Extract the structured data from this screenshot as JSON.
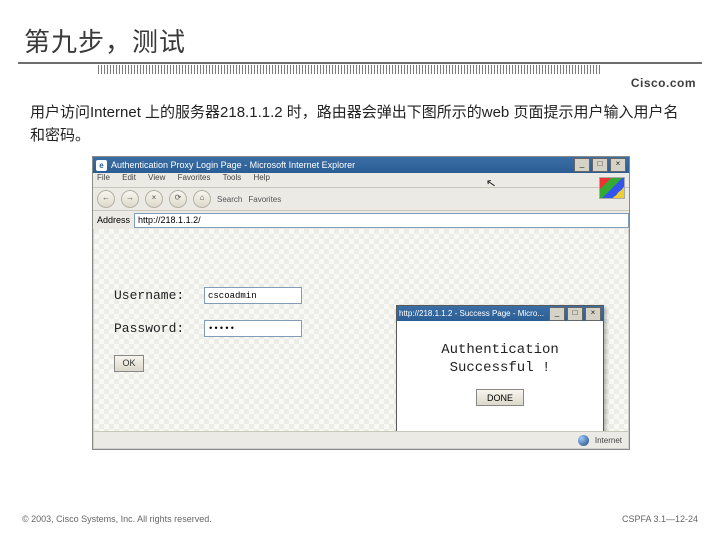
{
  "slide": {
    "title": "第九步，测试",
    "logo": "Cisco.com",
    "body": "用户访问Internet 上的服务器218.1.1.2 时，路由器会弹出下图所示的web 页面提示用户输入用户名和密码。",
    "copyright": "© 2003, Cisco Systems, Inc. All rights reserved.",
    "slidenum": "CSPFA 3.1—12-24"
  },
  "ie": {
    "title": "Authentication Proxy Login Page - Microsoft Internet Explorer",
    "menu": {
      "file": "File",
      "edit": "Edit",
      "view": "View",
      "fav": "Favorites",
      "tools": "Tools",
      "help": "Help"
    },
    "toolbar": {
      "back": "←",
      "fwd": "→",
      "stop": "×",
      "refresh": "⟳",
      "home": "⌂",
      "search": "Search",
      "fav": "Favorites"
    },
    "addr_label": "Address",
    "addr_value": "http://218.1.1.2/",
    "form": {
      "user_label": "Username:",
      "user_value": "cscoadmin",
      "pass_label": "Password:",
      "pass_value": "•••••",
      "ok": "OK"
    },
    "status": {
      "zone": "Internet"
    }
  },
  "popup": {
    "title": "http://218.1.1.2 - Success Page - Micro...",
    "line1": "Authentication",
    "line2": "Successful !",
    "btn": "DONE"
  }
}
